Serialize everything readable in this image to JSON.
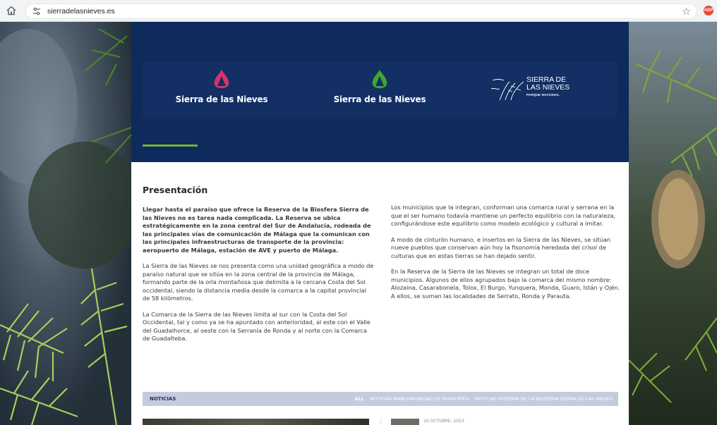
{
  "browser": {
    "url": "sierradelasnieves.es",
    "home_icon": "home-icon",
    "site_settings_icon": "tune-icon",
    "bookmark_icon": "star-icon",
    "extension_icon": "adblock-icon",
    "extension_label": "ABP"
  },
  "hero": {
    "logos": [
      {
        "name": "Sierra de las Nieves",
        "icon": "mountain-drop-icon",
        "color": "#d6336c"
      },
      {
        "name": "Sierra de las Nieves",
        "icon": "mountain-drop-icon",
        "color": "#3fa535"
      },
      {
        "line1": "SIERRA DE",
        "line2": "LAS NIEVES",
        "line3": "PARQUE NACIONAL",
        "icon": "pinsapo-sketch-icon"
      }
    ],
    "background_color": "#0f2a5c",
    "accent_color": "#73b532"
  },
  "presentation": {
    "title": "Presentación",
    "left_paragraphs": [
      "Llegar hasta el paraíso que ofrece la Reserva de la Biosfera Sierra de las Nieves no es tarea nada complicada. La Reserva se ubica estratégicamente en la zona central del Sur de Andalucía, rodeada de las principales vías de comunicación de Málaga que la comunican con las principales infraestructuras de transporte de la provincia: aeropuerto de Málaga, estación de AVE y puerto de Málaga.",
      "La Sierra de las Nieves se nos presenta como una unidad geográfica a modo de paraíso natural que se sitúa en la zona central de la provincia de Málaga, formando parte de la orla montañosa que delimita a la cercana Costa del Sol occidental, siendo la distancia media desde la comarca a la capital provincial de 58 kilómetros.",
      "La Comarca de la Sierra de las Nieves limita al sur con la Costa del Sol Occidental, tal y como ya se ha apuntado con anterioridad, al este con el Valle del Guadalhorce, al oeste con la Serranía de Ronda y al norte con la Comarca de Guadalteba."
    ],
    "right_paragraphs": [
      "Los municipios que la integran, conforman una comarca rural y serrana en la que el ser humano todavía mantiene un perfecto equilibrio con la naturaleza, configurándose este equilibrio como modelo ecológico y cultural a imitar.",
      "A modo de cinturón humano, e insertos en la Sierra de las Nieves, se sitúan nueve pueblos que conservan aún hoy la fisonomía heredada del crisol de culturas que en estas tierras se han dejado sentir.",
      "En la Reserva de la Sierra de las Nieves se integran un total de doce municipios. Algunos de ellos agrupados bajo la comarca del mismo nombre: Alozaina, Casarabonela, Tolox, El Burgo, Yunquera, Monda, Guaro, Istán y Ojén. A ellos, se suman las localidades de Serrato, Ronda y Parauta."
    ]
  },
  "news": {
    "label": "NOTICIAS",
    "filters": [
      "ALL",
      "NOTICIAS MANCOMUNIDAD DE MUNICIPIOS",
      "NOTICIAS RESERVA DE LA BIOSFERA SIERRA DE LAS NIEVES"
    ],
    "first_item_date": "10 OCTUBRE, 2023"
  }
}
